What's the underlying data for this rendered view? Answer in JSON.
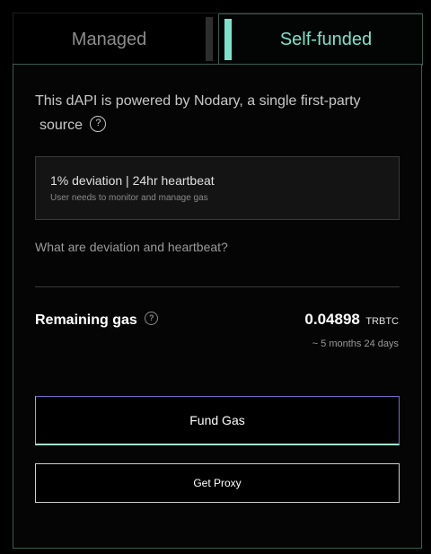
{
  "tabs": [
    {
      "label": "Managed",
      "selected": false
    },
    {
      "label": "Self-funded",
      "selected": true
    }
  ],
  "description": {
    "line1": "This dAPI is powered by Nodary, a single first-party",
    "line2": "source",
    "help_icon": "question-circle-icon"
  },
  "info_box": {
    "title": "1% deviation | 24hr heartbeat",
    "subtitle": "User needs to monitor and manage gas"
  },
  "link_question": "What are deviation and heartbeat?",
  "gas": {
    "label": "Remaining gas",
    "amount": "0.04898",
    "unit": "TRBTC",
    "time_remaining": "~ 5 months 24 days"
  },
  "buttons": {
    "fund_gas": "Fund Gas",
    "get_proxy": "Get Proxy"
  },
  "colors": {
    "accent": "#7ce3cb",
    "background": "#000000",
    "panel_border": "#3c5c54"
  }
}
